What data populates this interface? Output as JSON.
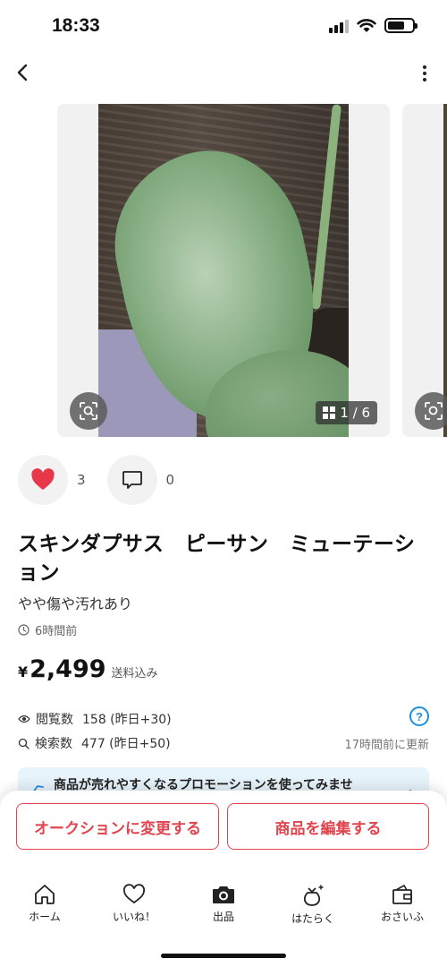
{
  "status_bar": {
    "time": "18:33"
  },
  "gallery": {
    "counter": "1 / 6"
  },
  "actions": {
    "likes": "3",
    "comments": "0"
  },
  "item": {
    "title": "スキンダプサス　ピーサン　ミューテーション",
    "condition": "やや傷や汚れあり",
    "posted": "6時間前",
    "price_symbol": "¥",
    "price": "2,499",
    "shipping": "送料込み"
  },
  "stats": {
    "views_label": "閲覧数",
    "views_value": "158 (昨日+30)",
    "search_label": "検索数",
    "search_value": "477 (昨日+50)",
    "updated": "17時間前に更新"
  },
  "promo": {
    "text": "商品が売れやすくなるプロモーションを使ってみませ"
  },
  "buttons": {
    "auction": "オークションに変更する",
    "edit": "商品を編集する"
  },
  "tabbar": {
    "home": "ホーム",
    "likes": "いいね！",
    "sell": "出品",
    "work": "はたらく",
    "wallet": "おさいふ"
  },
  "colors": {
    "accent": "#e0454f",
    "like": "#e8364a",
    "help": "#1e8fe0",
    "promo_bg": "#e8f4fb"
  }
}
